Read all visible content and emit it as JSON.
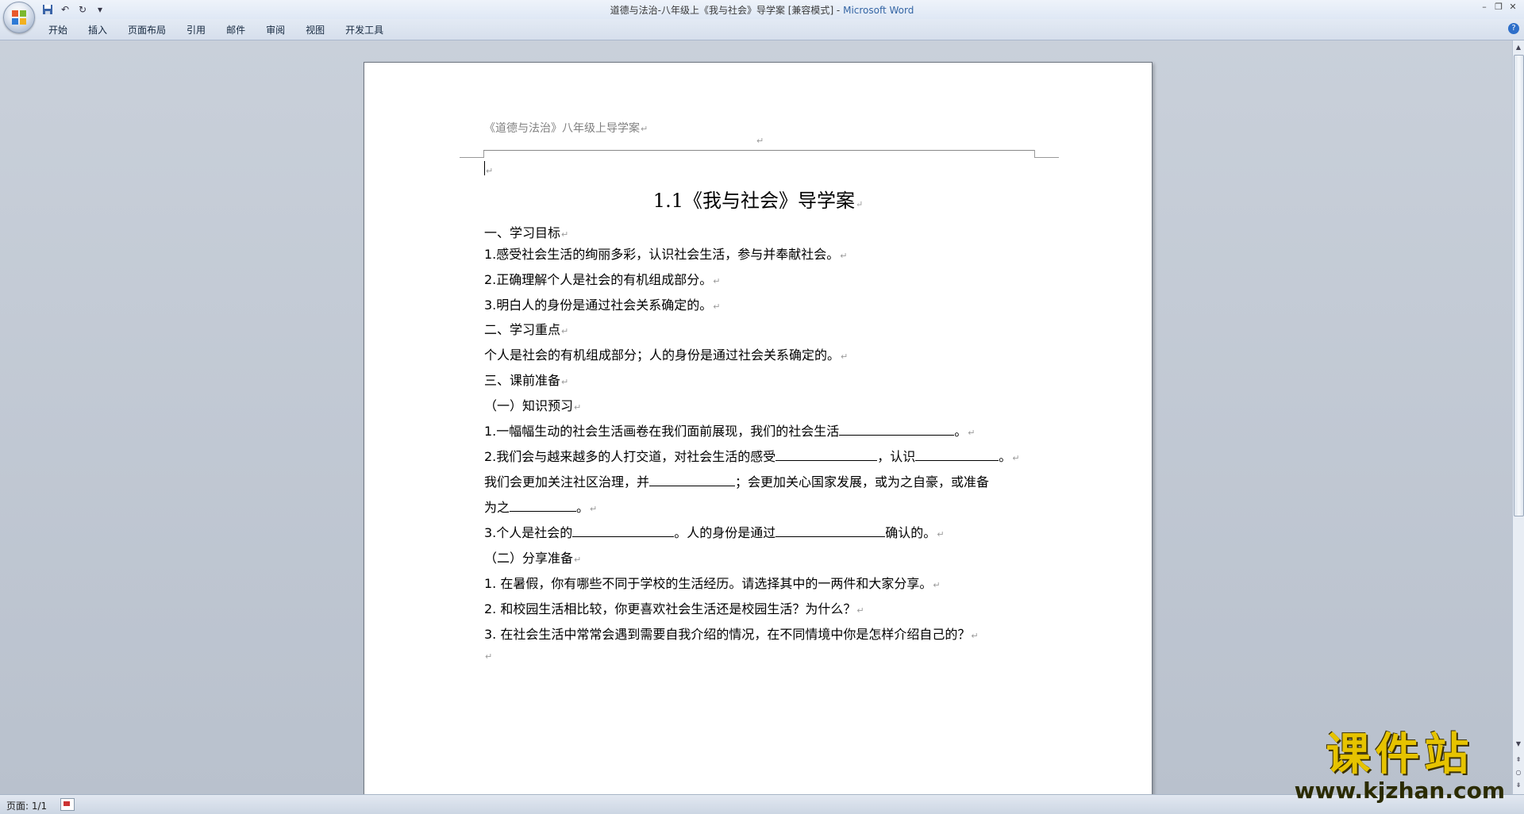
{
  "window": {
    "title": "道德与法治-八年级上《我与社会》导学案 [兼容模式] - ",
    "app_name": "Microsoft Word"
  },
  "ribbon": {
    "tabs": [
      "开始",
      "插入",
      "页面布局",
      "引用",
      "邮件",
      "审阅",
      "视图",
      "开发工具"
    ]
  },
  "document": {
    "header_text": "《道德与法治》八年级上导学案",
    "title": "1.1《我与社会》导学案",
    "lines": {
      "s1": "一、学习目标",
      "s1_1": "1.感受社会生活的绚丽多彩，认识社会生活，参与并奉献社会。",
      "s1_2": "2.正确理解个人是社会的有机组成部分。",
      "s1_3": "3.明白人的身份是通过社会关系确定的。",
      "s2": "二、学习重点",
      "s2_1": "个人是社会的有机组成部分；人的身份是通过社会关系确定的。",
      "s3": "三、课前准备",
      "s3a": "（一）知识预习",
      "q1_a": "1.一幅幅生动的社会生活画卷在我们面前展现，我们的社会生活",
      "q1_b": "。",
      "q2_a": "2.我们会与越来越多的人打交道，对社会生活的感受",
      "q2_b": "，认识",
      "q2_c": "。",
      "q2_d": "我们会更加关注社区治理，并",
      "q2_e": "；会更加关心国家发展，或为之自豪，或准备",
      "q2_f": "为之",
      "q2_g": "。",
      "q3_a": "3.个人是社会的",
      "q3_b": "。人的身份是通过",
      "q3_c": "确认的。",
      "s3b": "（二）分享准备",
      "p1": "1.  在暑假，你有哪些不同于学校的生活经历。请选择其中的一两件和大家分享。",
      "p2": "2.  和校园生活相比较，你更喜欢社会生活还是校园生活？为什么？",
      "p3": "3.  在社会生活中常常会遇到需要自我介绍的情况，在不同情境中你是怎样介绍自己的？"
    }
  },
  "status": {
    "page": "页面: 1/1"
  },
  "watermark": {
    "brand": "课件站",
    "url": "www.kjzhan.com"
  }
}
